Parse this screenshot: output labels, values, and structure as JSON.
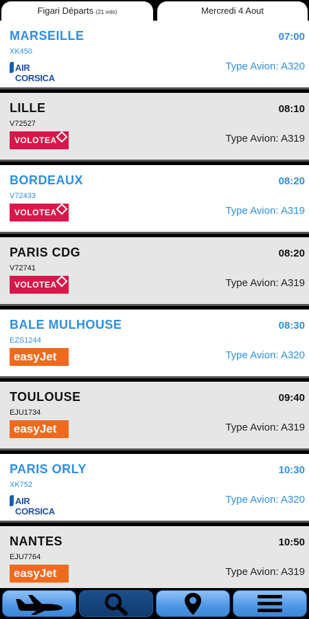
{
  "header": {
    "tab_left_title": "Figari Départs",
    "tab_left_count": "(21 vols)",
    "tab_right_date": "Mercredi 4 Aout"
  },
  "flights": [
    {
      "destination": "MARSEILLE",
      "flight": "XK450",
      "time": "07:00",
      "aircraft": "Type Avion: A320",
      "airline": "AIR CORSICA",
      "style": "white"
    },
    {
      "destination": "LILLE",
      "flight": "V72527",
      "time": "08:10",
      "aircraft": "Type Avion: A319",
      "airline": "VOLOTEA",
      "style": "grey"
    },
    {
      "destination": "BORDEAUX",
      "flight": "V72433",
      "time": "08:20",
      "aircraft": "Type Avion: A319",
      "airline": "VOLOTEA",
      "style": "white"
    },
    {
      "destination": "PARIS CDG",
      "flight": "V72741",
      "time": "08:20",
      "aircraft": "Type Avion: A319",
      "airline": "VOLOTEA",
      "style": "grey"
    },
    {
      "destination": "BALE MULHOUSE",
      "flight": "EZS1244",
      "time": "08:30",
      "aircraft": "Type Avion: A320",
      "airline": "easyJet",
      "style": "white"
    },
    {
      "destination": "TOULOUSE",
      "flight": "EJU1734",
      "time": "09:40",
      "aircraft": "Type Avion: A319",
      "airline": "easyJet",
      "style": "grey"
    },
    {
      "destination": "PARIS ORLY",
      "flight": "XK752",
      "time": "10:30",
      "aircraft": "Type Avion: A320",
      "airline": "AIR CORSICA",
      "style": "white"
    },
    {
      "destination": "NANTES",
      "flight": "EJU7764",
      "time": "10:50",
      "aircraft": "Type Avion: A319",
      "airline": "easyJet",
      "style": "grey"
    }
  ],
  "nav": [
    {
      "icon": "airplane-icon",
      "active": false
    },
    {
      "icon": "search-icon",
      "active": true
    },
    {
      "icon": "map-pin-icon",
      "active": false
    },
    {
      "icon": "menu-icon",
      "active": false
    }
  ],
  "colors": {
    "highlight_blue": "#2e8fe0",
    "volotea_red": "#d9174a",
    "easyjet_orange": "#f06a1e",
    "aircorsica_blue": "#1b4f9c",
    "row_grey": "#e6e6e6"
  }
}
